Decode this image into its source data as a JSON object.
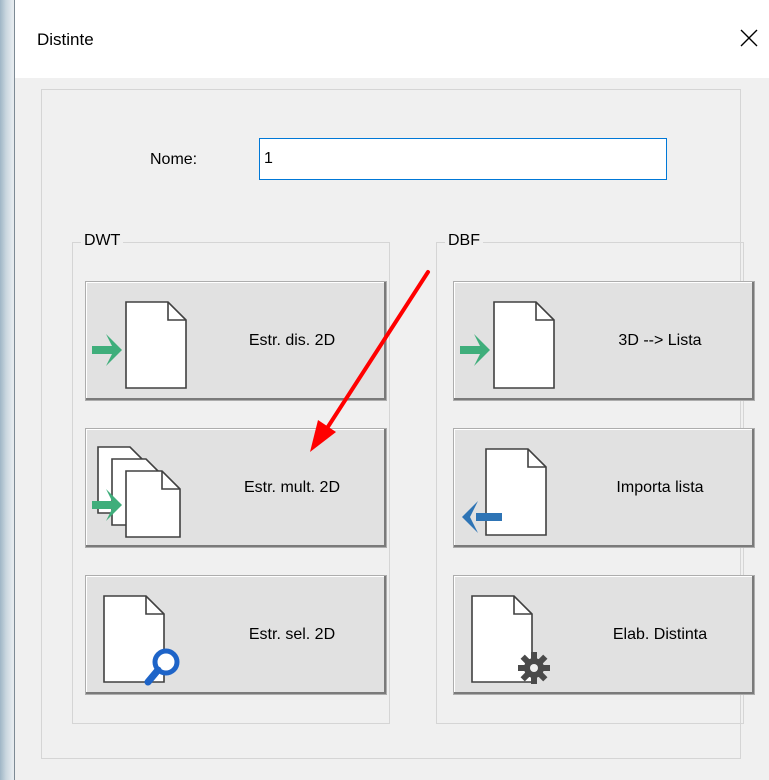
{
  "window": {
    "title": "Distinte"
  },
  "form": {
    "name_label": "Nome:",
    "name_value": "1"
  },
  "groups": {
    "dwt": {
      "label": "DWT",
      "buttons": [
        {
          "label": "Estr. dis. 2D",
          "icon": "document-import-icon"
        },
        {
          "label": "Estr. mult. 2D",
          "icon": "multi-document-import-icon"
        },
        {
          "label": "Estr. sel. 2D",
          "icon": "document-search-icon"
        }
      ]
    },
    "dbf": {
      "label": "DBF",
      "buttons": [
        {
          "label": "3D --> Lista",
          "icon": "document-import-icon"
        },
        {
          "label": "Importa lista",
          "icon": "document-export-icon"
        },
        {
          "label": "Elab. Distinta",
          "icon": "document-gear-icon"
        }
      ]
    }
  },
  "colors": {
    "import_arrow": "#3fae7b",
    "export_arrow": "#2e74b5",
    "search_icon": "#1e64c8",
    "gear_icon": "#4a4a4a",
    "annotation_arrow": "#ff0000",
    "focus_border": "#0078d7"
  }
}
